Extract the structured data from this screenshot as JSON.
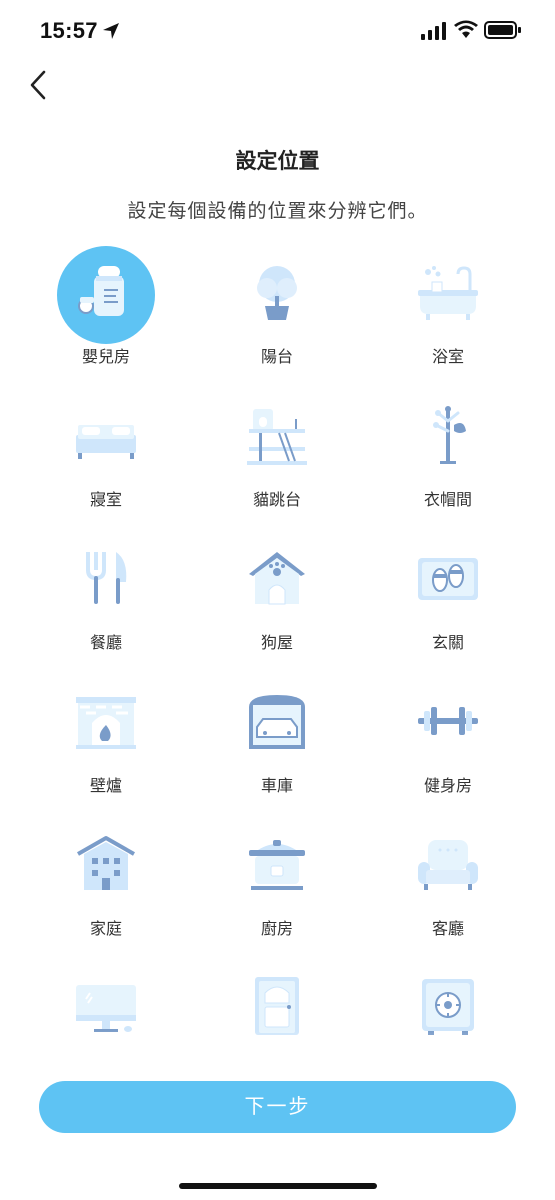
{
  "status": {
    "time": "15:57"
  },
  "header": {
    "title": "設定位置",
    "subtitle": "設定每個設備的位置來分辨它們。"
  },
  "locations": [
    {
      "label": "嬰兒房",
      "icon": "baby-bottle-icon",
      "selected": true
    },
    {
      "label": "陽台",
      "icon": "potted-tree-icon",
      "selected": false
    },
    {
      "label": "浴室",
      "icon": "bathtub-icon",
      "selected": false
    },
    {
      "label": "寢室",
      "icon": "bed-icon",
      "selected": false
    },
    {
      "label": "貓跳台",
      "icon": "cat-tree-icon",
      "selected": false
    },
    {
      "label": "衣帽間",
      "icon": "coat-rack-icon",
      "selected": false
    },
    {
      "label": "餐廳",
      "icon": "fork-knife-icon",
      "selected": false
    },
    {
      "label": "狗屋",
      "icon": "doghouse-icon",
      "selected": false
    },
    {
      "label": "玄關",
      "icon": "slippers-mat-icon",
      "selected": false
    },
    {
      "label": "壁爐",
      "icon": "fireplace-icon",
      "selected": false
    },
    {
      "label": "車庫",
      "icon": "garage-car-icon",
      "selected": false
    },
    {
      "label": "健身房",
      "icon": "dumbbell-icon",
      "selected": false
    },
    {
      "label": "家庭",
      "icon": "house-icon",
      "selected": false
    },
    {
      "label": "廚房",
      "icon": "rice-cooker-icon",
      "selected": false
    },
    {
      "label": "客廳",
      "icon": "armchair-icon",
      "selected": false
    },
    {
      "label": "",
      "icon": "monitor-icon",
      "selected": false
    },
    {
      "label": "",
      "icon": "door-icon",
      "selected": false
    },
    {
      "label": "",
      "icon": "safe-icon",
      "selected": false
    }
  ],
  "footer": {
    "next_label": "下一步"
  },
  "colors": {
    "accent": "#5ec3f3",
    "icon_light": "#cfe6fb",
    "icon_dark": "#7a9cc9"
  }
}
